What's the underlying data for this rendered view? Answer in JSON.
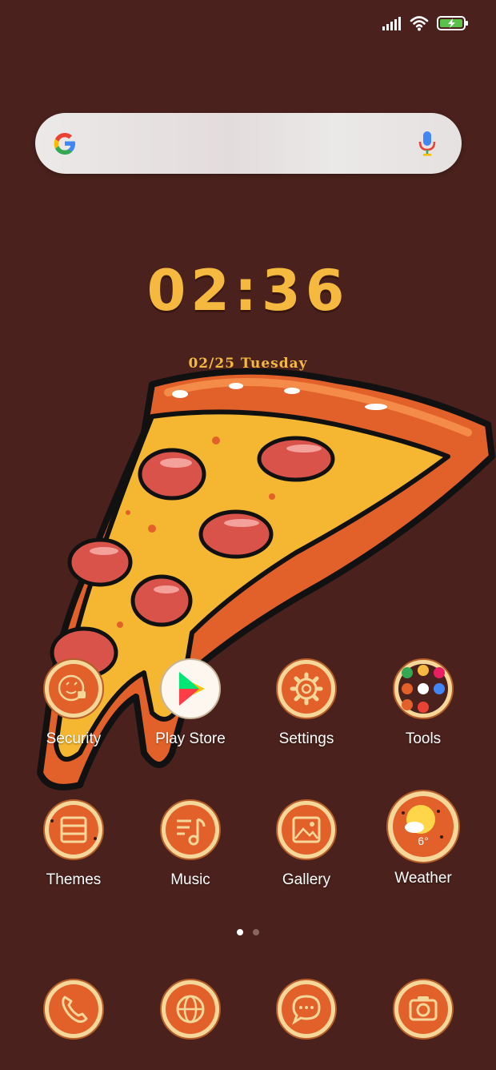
{
  "status_bar": {
    "icons": [
      "signal-icon",
      "wifi-icon",
      "battery-charging-icon"
    ]
  },
  "search": {
    "left_icon": "google-g-icon",
    "right_icon": "microphone-icon"
  },
  "clock": {
    "time": "02:36"
  },
  "date": {
    "text": "02/25 Tuesday"
  },
  "apps_row1": [
    {
      "label": "Security",
      "icon": "security-face-icon"
    },
    {
      "label": "Play Store",
      "icon": "play-store-icon"
    },
    {
      "label": "Settings",
      "icon": "gear-icon"
    },
    {
      "label": "Tools",
      "icon": "folder-icon"
    }
  ],
  "apps_row2": [
    {
      "label": "Themes",
      "icon": "themes-icon"
    },
    {
      "label": "Music",
      "icon": "music-icon"
    },
    {
      "label": "Gallery",
      "icon": "gallery-icon"
    },
    {
      "label": "Weather",
      "icon": "weather-icon",
      "temp": "6°"
    }
  ],
  "page_indicator": {
    "count": 2,
    "active": 0
  },
  "dock": [
    {
      "icon": "phone-icon"
    },
    {
      "icon": "browser-globe-icon"
    },
    {
      "icon": "messages-icon"
    },
    {
      "icon": "camera-icon"
    }
  ],
  "colors": {
    "background": "#4a211c",
    "accent": "#f4b93e",
    "pizza_sauce": "#e2612a",
    "pepperoni": "#d9534a"
  }
}
